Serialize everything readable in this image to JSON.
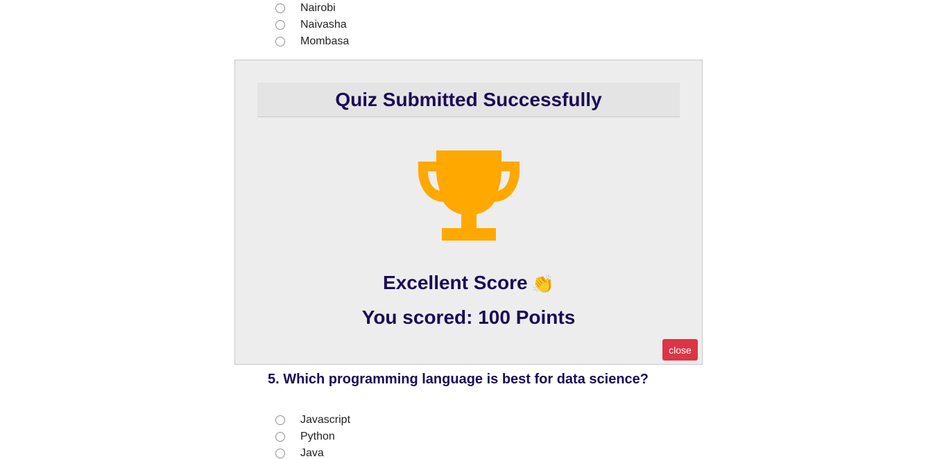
{
  "previous_question": {
    "options": [
      "Nairobi",
      "Naivasha",
      "Mombasa"
    ]
  },
  "modal": {
    "title": "Quiz Submitted Successfully",
    "icon": "trophy-icon",
    "score_message": "Excellent Score",
    "score_emoji": "👏",
    "score_text": "You scored: 100 Points",
    "close_label": "close",
    "colors": {
      "trophy": "#ffa800",
      "title": "#1b0b57",
      "close_button": "#dc3545"
    }
  },
  "question_5": {
    "text": "5. Which programming language is best for data science?",
    "options": [
      "Javascript",
      "Python",
      "Java"
    ]
  }
}
